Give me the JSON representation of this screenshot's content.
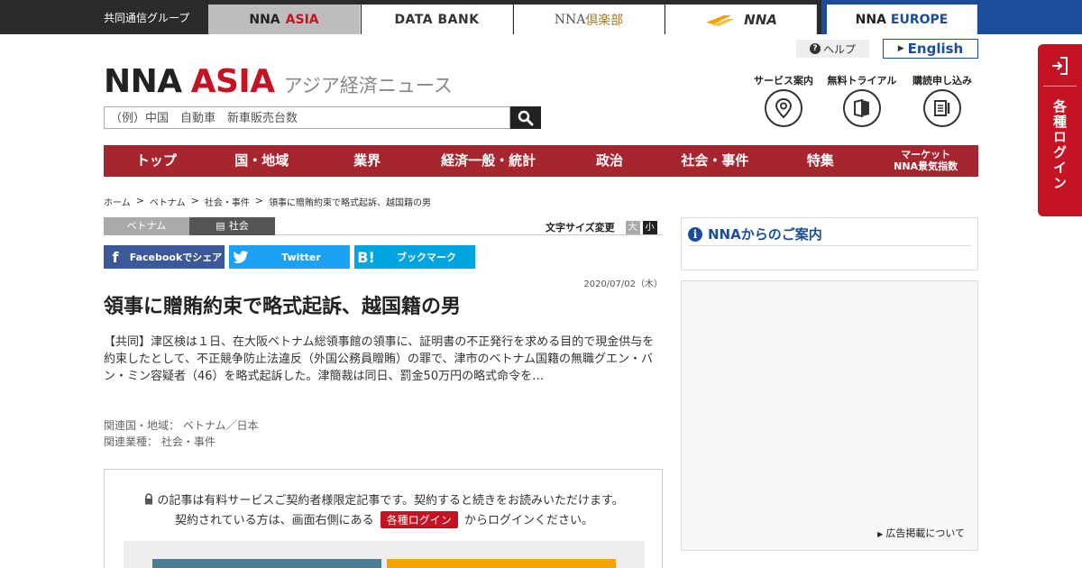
{
  "topbar": {
    "group_label": "共同通信グループ",
    "sites": {
      "asia_nna": "NNA",
      "asia_asia": "ASIA",
      "data_bank": "DATA BANK",
      "club_nna": "NNA",
      "club_kj": "倶楽部",
      "nna_logo": "NNA",
      "europe_nna": "NNA",
      "europe_eu": "EUROPE"
    }
  },
  "header": {
    "help_label": "ヘルプ",
    "english_label": "English",
    "logo_nna": "NNA",
    "logo_asia": "ASIA",
    "logo_sub": "アジア経済ニュース",
    "search_placeholder": "（例）中国　自動車　新車販売台数",
    "services": {
      "guide": "サービス案内",
      "trial": "無料トライアル",
      "subscribe": "購読申し込み"
    }
  },
  "nav": {
    "top": "トップ",
    "region": "国・地域",
    "industry": "業界",
    "economy": "経済一般・統計",
    "politics": "政治",
    "society": "社会・事件",
    "special": "特集",
    "market_1": "マーケット",
    "market_2": "NNA景気指数"
  },
  "login_tab": {
    "label": "各種ログイン"
  },
  "breadcrumb": {
    "home": "ホーム",
    "country": "ベトナム",
    "category": "社会・事件",
    "current": "領事に贈賄約束で略式起訴、越国籍の男"
  },
  "article": {
    "tag_country": "ベトナム",
    "tag_category": "社会",
    "font_size_label": "文字サイズ変更",
    "font_large": "大",
    "font_small": "小",
    "share_facebook": "Facebookでシェア",
    "share_twitter": "Twitter",
    "share_hatena": "ブックマーク",
    "date": "2020/07/02（木）",
    "headline": "領事に贈賄約束で略式起訴、越国籍の男",
    "body": "【共同】津区検は１日、在大阪ベトナム総領事館の領事に、証明書の不正発行を求める目的で現金供与を約束したとして、不正競争防止法違反（外国公務員贈賄）の罪で、津市のベトナム国籍の無職グエン・バン・ミン容疑者（46）を略式起訴した。津簡裁は同日、罰金50万円の略式命令を…",
    "related_region_label": "関連国・地域：",
    "related_region": "ベトナム／日本",
    "related_industry_label": "関連業種：",
    "related_industry": "社会・事件"
  },
  "paywall": {
    "line1": "の記事は有料サービスご契約者様限定記事です。契約すると続きをお読みいただけます。",
    "line2_pre": "契約されている方は、画面右側にある",
    "login_badge": "各種ログイン",
    "line2_post": "からログインください。"
  },
  "sidebar": {
    "info_title": "NNAからのご案内",
    "ad_link": "広告掲載について"
  },
  "colors": {
    "brand_red": "#c41424",
    "nav_red": "#a6262f",
    "brand_blue": "#1b4d9a"
  }
}
